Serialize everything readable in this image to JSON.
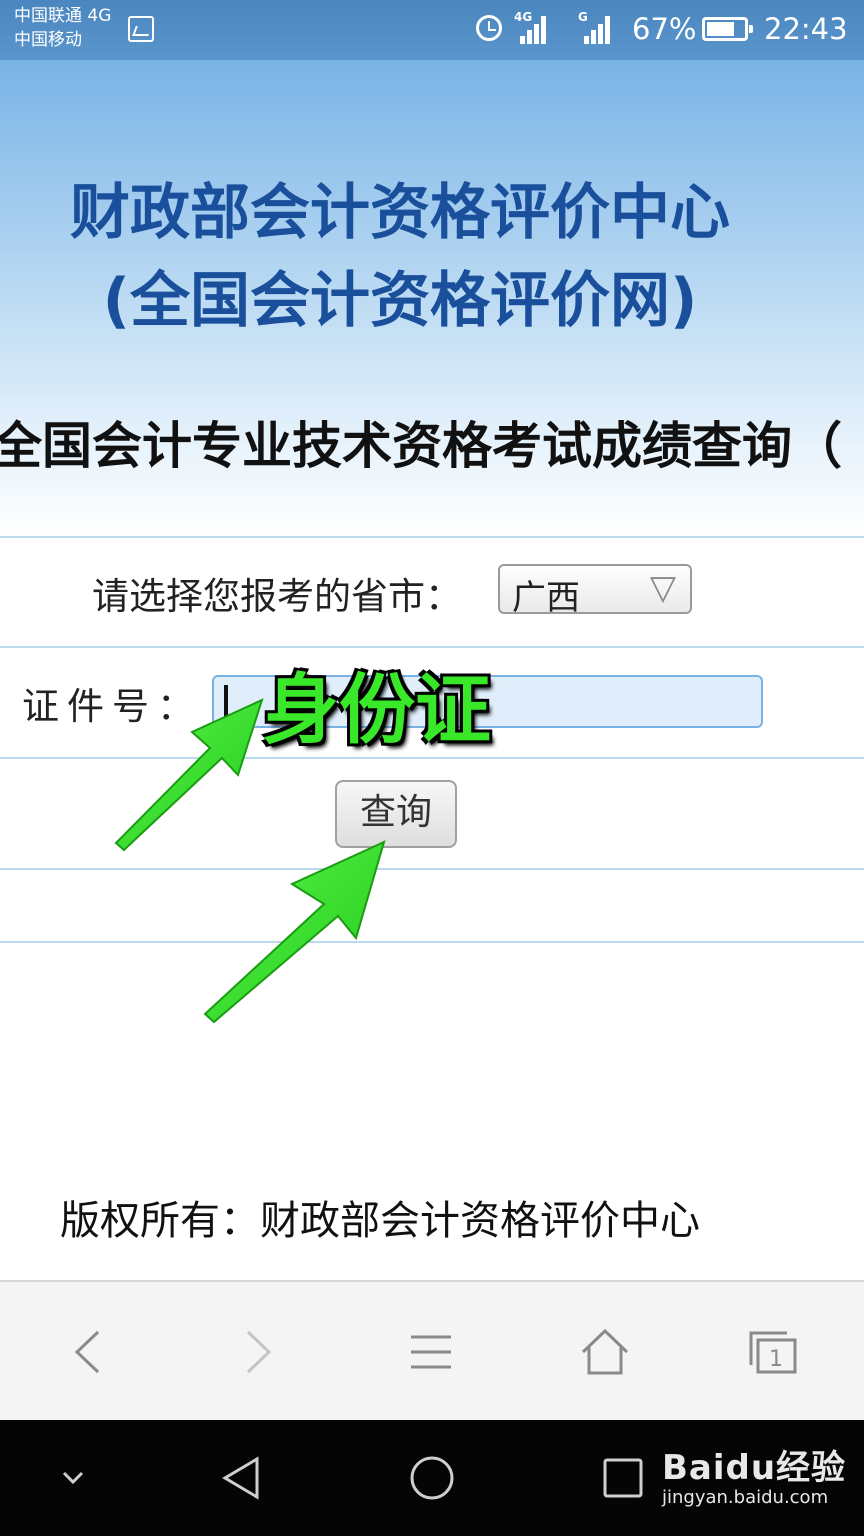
{
  "status_bar": {
    "carrier1": "中国联通 4G",
    "carrier2": "中国移动",
    "signal1_label": "4G",
    "signal2_label": "G",
    "battery_percent": "67%",
    "battery_level": 0.67,
    "time": "22:43",
    "icons": [
      "image-notification-icon",
      "alarm-icon",
      "signal-icon",
      "battery-icon"
    ]
  },
  "header": {
    "title_line1": "财政部会计资格评价中心",
    "title_line2": "(全国会计资格评价网)",
    "subtitle": "全国会计专业技术资格考试成绩查询（"
  },
  "form": {
    "province_label": "请选择您报考的省市：",
    "province_value": "广西",
    "id_label": "证件号：",
    "id_value": "",
    "submit_label": "查询"
  },
  "annotation": {
    "text": "身份证",
    "color": "#3ae82a"
  },
  "footer": {
    "copyright": "版权所有：财政部会计资格评价中心"
  },
  "browser_toolbar": {
    "icons": [
      "back-icon",
      "forward-icon",
      "menu-icon",
      "home-icon",
      "tabs-icon"
    ],
    "tab_count": "1"
  },
  "nav_bar": {
    "icons": [
      "collapse-icon",
      "back-triangle-icon",
      "home-circle-icon",
      "recents-square-icon"
    ]
  },
  "watermark": {
    "main": "Baidu经验",
    "url": "jingyan.baidu.com"
  },
  "colors": {
    "title_blue": "#1a4f9c",
    "header_gradient_top": "#79b3e6",
    "arrow_green": "#3ae82a",
    "status_bar_bg": "#4a86bf"
  }
}
